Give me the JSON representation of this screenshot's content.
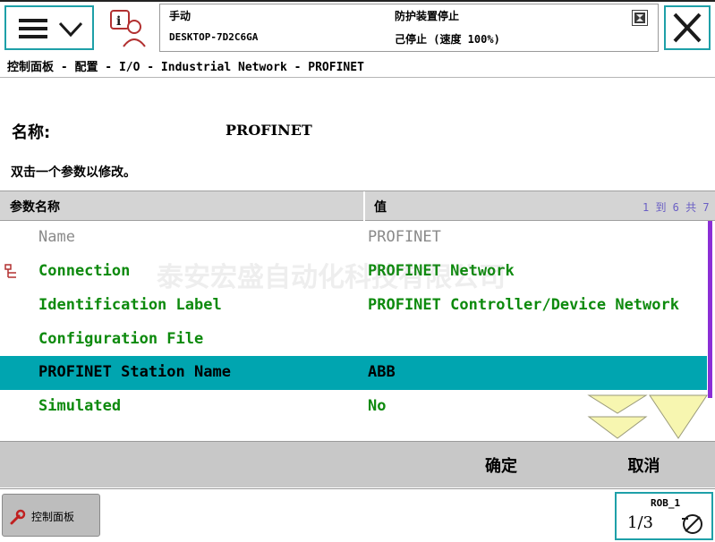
{
  "topbar": {
    "mode": "手动",
    "host": "DESKTOP-7D2C6GA",
    "guard_status": "防护装置停止",
    "run_status": "己停止 (速度 100%)"
  },
  "breadcrumb": "控制面板 - 配置 - I/O - Industrial Network - PROFINET",
  "name_label": "名称:",
  "name_value": "PROFINET",
  "hint": "双击一个参数以修改。",
  "table": {
    "col_name": "参数名称",
    "col_value": "值",
    "page_info": "1 到 6 共 7",
    "rows": [
      {
        "name": "Name",
        "value": "PROFINET",
        "style": "muted"
      },
      {
        "name": "Connection",
        "value": "PROFINET Network",
        "style": "green",
        "icon": "connection-icon"
      },
      {
        "name": "Identification Label",
        "value": "PROFINET Controller/Device Network",
        "style": "green"
      },
      {
        "name": "Configuration File",
        "value": "",
        "style": "green"
      },
      {
        "name": "PROFINET Station Name",
        "value": "ABB",
        "style": "selected"
      },
      {
        "name": "Simulated",
        "value": "No",
        "style": "green"
      }
    ]
  },
  "watermark": "泰安宏盛自动化科技有限公司",
  "actions": {
    "ok": "确定",
    "cancel": "取消"
  },
  "taskbar": {
    "control_panel": "控制面板",
    "rob_label": "ROB_1",
    "rob_fraction": "1/3"
  },
  "colors": {
    "accent": "#1ea0a8",
    "selected_row": "#00a5b0",
    "editable_text": "#0d8a0d",
    "scrollbar": "#8b2fd6",
    "nav_arrow": "#f7f6b0"
  },
  "icons": [
    "menu-icon",
    "info-user-icon",
    "flag-icon",
    "close-icon",
    "connection-icon",
    "scroll-down-page-icon",
    "scroll-down-icon",
    "wrench-icon",
    "motor-off-icon"
  ]
}
